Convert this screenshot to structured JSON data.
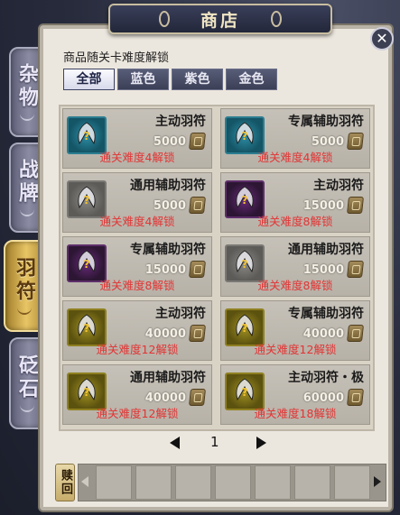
{
  "title": "商店",
  "side_tabs": [
    {
      "label": "杂物",
      "active": false
    },
    {
      "label": "战牌",
      "active": false
    },
    {
      "label": "羽符",
      "active": true
    },
    {
      "label": "砭石",
      "active": false
    }
  ],
  "unlock_hint": "商品随关卡难度解锁",
  "filter_tabs": [
    {
      "label": "全部",
      "active": true
    },
    {
      "label": "蓝色",
      "active": false
    },
    {
      "label": "紫色",
      "active": false
    },
    {
      "label": "金色",
      "active": false
    }
  ],
  "items": [
    {
      "name": "主动羽符",
      "price": "5000",
      "unlock": "通关难度4解锁",
      "quality": "blue"
    },
    {
      "name": "专属辅助羽符",
      "price": "5000",
      "unlock": "通关难度4解锁",
      "quality": "blue"
    },
    {
      "name": "通用辅助羽符",
      "price": "5000",
      "unlock": "通关难度4解锁",
      "quality": "gray"
    },
    {
      "name": "主动羽符",
      "price": "15000",
      "unlock": "通关难度8解锁",
      "quality": "purple"
    },
    {
      "name": "专属辅助羽符",
      "price": "15000",
      "unlock": "通关难度8解锁",
      "quality": "purple"
    },
    {
      "name": "通用辅助羽符",
      "price": "15000",
      "unlock": "通关难度8解锁",
      "quality": "gray"
    },
    {
      "name": "主动羽符",
      "price": "40000",
      "unlock": "通关难度12解锁",
      "quality": "gold"
    },
    {
      "name": "专属辅助羽符",
      "price": "40000",
      "unlock": "通关难度12解锁",
      "quality": "gold"
    },
    {
      "name": "通用辅助羽符",
      "price": "40000",
      "unlock": "通关难度12解锁",
      "quality": "gold"
    },
    {
      "name": "主动羽符・极",
      "price": "60000",
      "unlock": "通关难度18解锁",
      "quality": "gold"
    }
  ],
  "pagination": {
    "page": "1"
  },
  "redeem_label": "赎回",
  "colors": {
    "unlock_text": "#e33434",
    "active_side_tab": "#e8c565",
    "panel_bg": "#ece7de"
  }
}
